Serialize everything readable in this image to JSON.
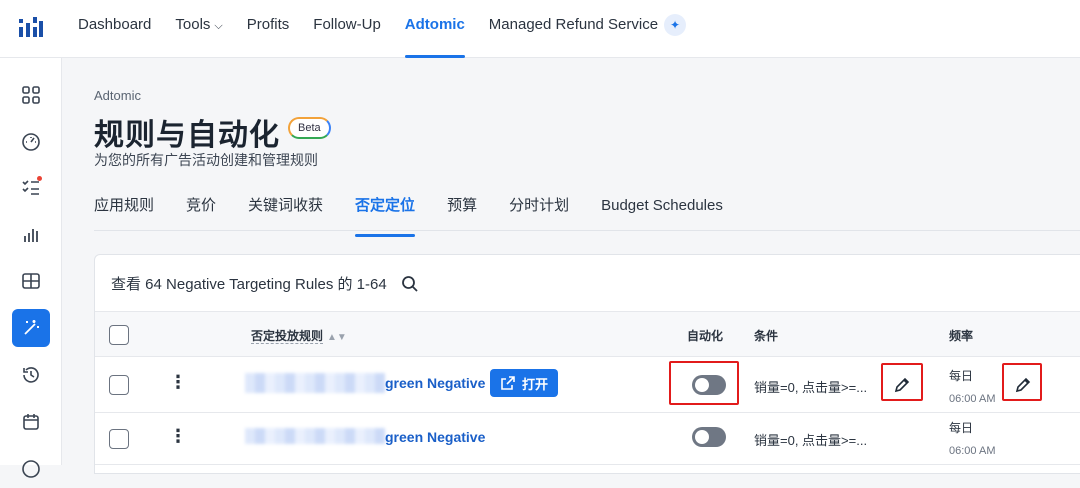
{
  "topnav": {
    "items": [
      {
        "label": "Dashboard"
      },
      {
        "label": "Tools"
      },
      {
        "label": "Profits"
      },
      {
        "label": "Follow-Up"
      },
      {
        "label": "Adtomic",
        "active": true
      },
      {
        "label": "Managed Refund Service"
      }
    ],
    "accent": "#1a73e8"
  },
  "sidebar": {
    "icons": [
      "grid-icon",
      "gauge-icon",
      "checklist-icon",
      "bar-chart-icon",
      "table-icon",
      "magic-wand-icon",
      "history-icon",
      "calendar-icon",
      "more-icon"
    ],
    "active": "magic-wand-icon"
  },
  "header": {
    "breadcrumb": "Adtomic",
    "title": "规则与自动化",
    "beta": "Beta",
    "subtitle": "为您的所有广告活动创建和管理规则"
  },
  "tabs": [
    {
      "label": "应用规则"
    },
    {
      "label": "竞价"
    },
    {
      "label": "关键词收获"
    },
    {
      "label": "否定定位",
      "active": true
    },
    {
      "label": "预算"
    },
    {
      "label": "分时计划"
    },
    {
      "label": "Budget Schedules"
    }
  ],
  "table": {
    "summary": "查看 64 Negative Targeting Rules 的 1-64",
    "columns": {
      "rule": "否定投放规则",
      "automation": "自动化",
      "condition": "条件",
      "frequency": "频率"
    },
    "rows": [
      {
        "name_visible": "green Negative",
        "open_label": "打开",
        "condition": "销量=0, 点击量>=...",
        "frequency": "每日",
        "time": "06:00 AM",
        "automation_on": false
      },
      {
        "name_visible": "green Negative",
        "condition": "销量=0, 点击量>=...",
        "frequency": "每日",
        "time": "06:00 AM",
        "automation_on": false
      }
    ]
  },
  "highlight_color": "#e21b1b"
}
